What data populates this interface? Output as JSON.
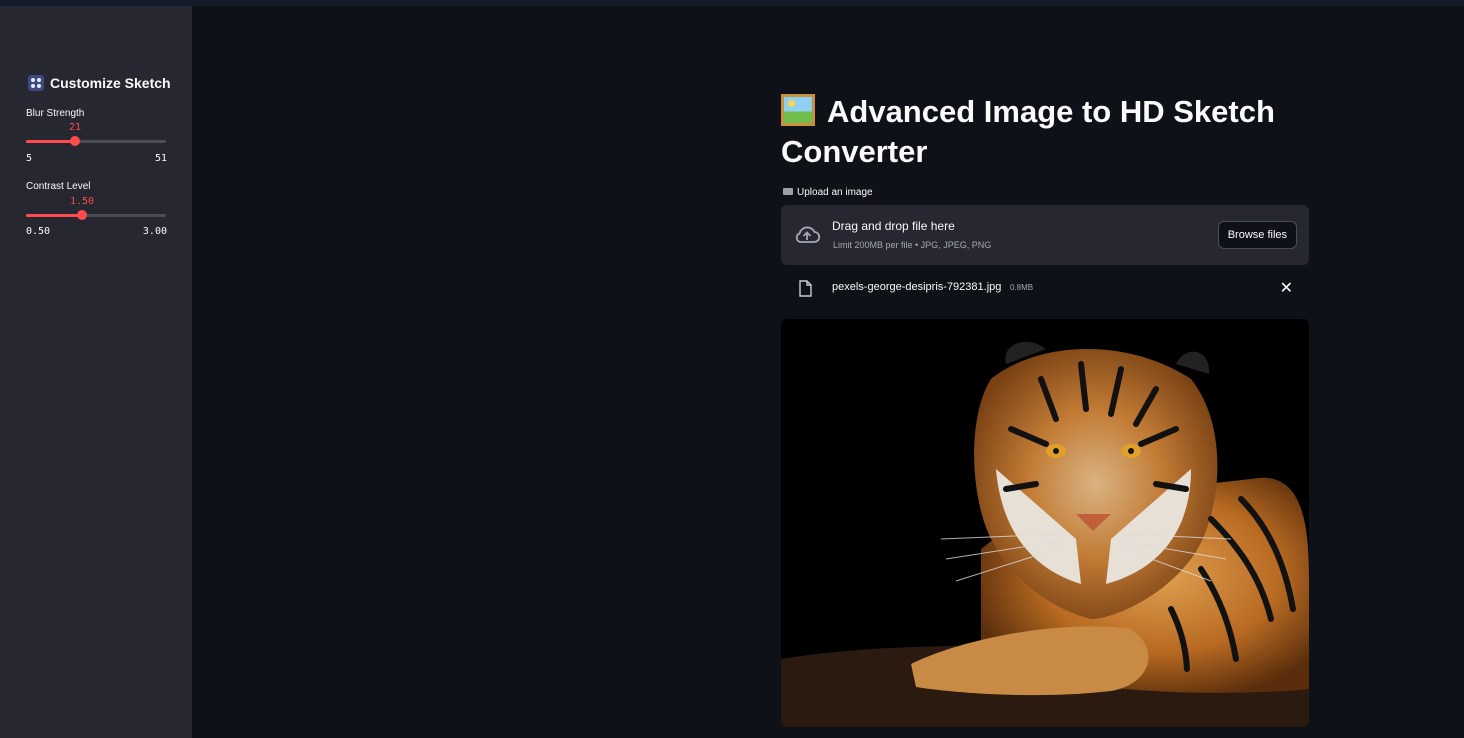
{
  "sidebar": {
    "title": "Customize Sketch",
    "title_icon": "control-knobs-icon",
    "blur": {
      "label": "Blur Strength",
      "value": "21",
      "min": "5",
      "max": "51",
      "fraction": 0.348
    },
    "contrast": {
      "label": "Contrast Level",
      "value": "1.50",
      "min": "0.50",
      "max": "3.00",
      "fraction": 0.4
    }
  },
  "main": {
    "title": "Advanced Image to HD Sketch Converter",
    "title_icon": "framed-picture-icon",
    "uploader": {
      "label": "Upload an image",
      "drop_text": "Drag and drop file here",
      "limit_text": "Limit 200MB per file • JPG, JPEG, PNG",
      "browse_label": "Browse files"
    },
    "file": {
      "name": "pexels-george-desipris-792381.jpg",
      "size": "0.8MB"
    },
    "image": {
      "subject": "tiger-photo"
    }
  },
  "colors": {
    "accent": "#ff4b4b",
    "background": "#0e1117",
    "sidebar": "#262730"
  }
}
